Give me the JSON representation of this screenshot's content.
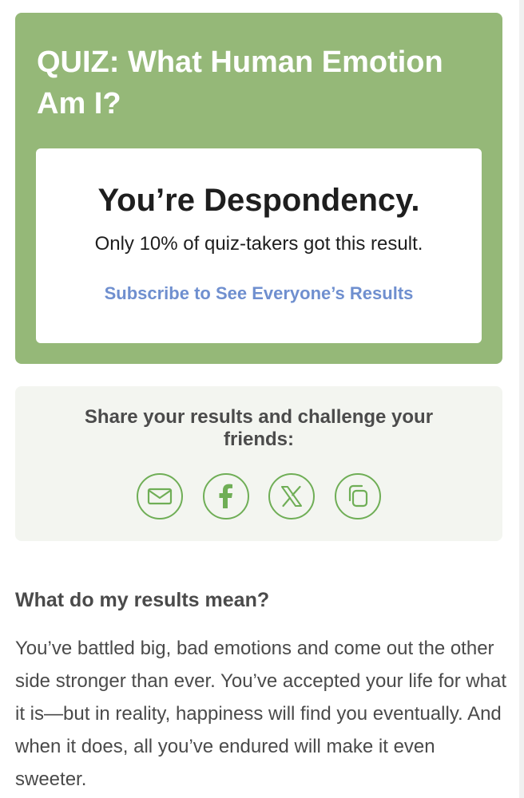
{
  "quiz": {
    "title": "QUIZ: What Human Emotion Am I?",
    "result_heading": "You’re Despondency.",
    "result_subtext": "Only 10% of quiz-takers got this result.",
    "subscribe_link": "Subscribe to See Everyone’s Results"
  },
  "share": {
    "prompt": "Share your results and challenge your friends:",
    "icons": [
      {
        "name": "email-icon"
      },
      {
        "name": "facebook-icon"
      },
      {
        "name": "x-icon"
      },
      {
        "name": "copy-icon"
      }
    ]
  },
  "results_section": {
    "heading": "What do my results mean?",
    "body": "You’ve battled big, bad emotions and come out the other side stronger than ever. You’ve accepted your life for what it is—but in reality, happiness will find you eventually. And when it does, all you’ve endured will make it even sweeter."
  },
  "colors": {
    "quiz_card": "#95b878",
    "link": "#6f8fcf",
    "share_icon": "#6fae56",
    "share_panel": "#f3f5f0",
    "body_text": "#4a4a4a"
  }
}
